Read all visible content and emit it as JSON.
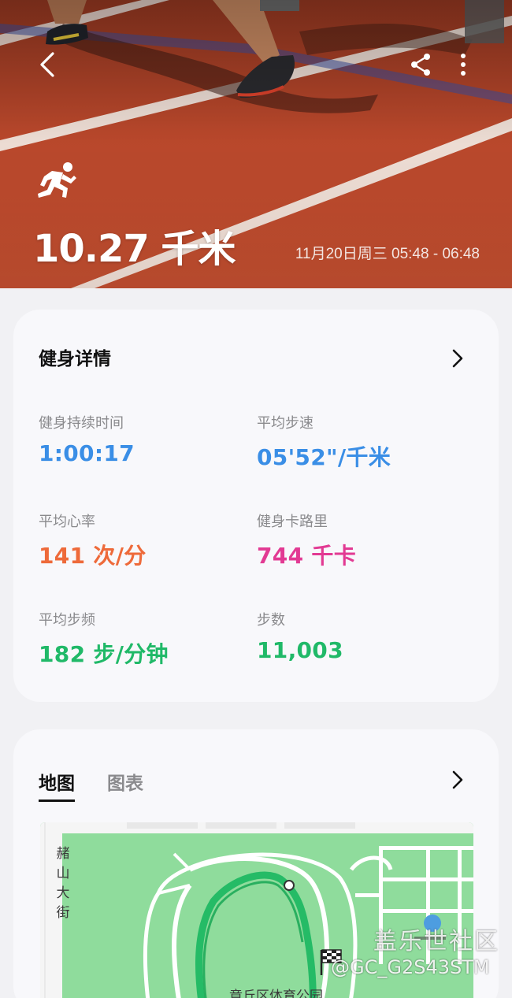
{
  "hero": {
    "distance": "10.27 千米",
    "datetime": "11月20日周三 05:48 - 06:48",
    "icons": {
      "back": "back-arrow-icon",
      "share": "share-icon",
      "more": "more-vert-icon",
      "activity": "running-icon"
    }
  },
  "details": {
    "title": "健身详情",
    "stats": [
      {
        "label": "健身持续时间",
        "value": "1:00:17",
        "color": "#3a8ee6"
      },
      {
        "label": "平均步速",
        "value": "05'52\"/千米",
        "color": "#3a8ee6"
      },
      {
        "label": "平均心率",
        "value": "141 次/分",
        "color": "#ee6a3a"
      },
      {
        "label": "健身卡路里",
        "value": "744 千卡",
        "color": "#e23a93"
      },
      {
        "label": "平均步频",
        "value": "182 步/分钟",
        "color": "#20b968"
      },
      {
        "label": "步数",
        "value": "11,003",
        "color": "#20b968"
      }
    ]
  },
  "map_section": {
    "tabs": [
      "地图",
      "图表"
    ],
    "active_tab": "地图",
    "street_label": "赭山大街",
    "park_label": "章丘区体育公园"
  },
  "watermark": {
    "site": "盖乐世社区",
    "user": "@GC_G2S43STM"
  }
}
